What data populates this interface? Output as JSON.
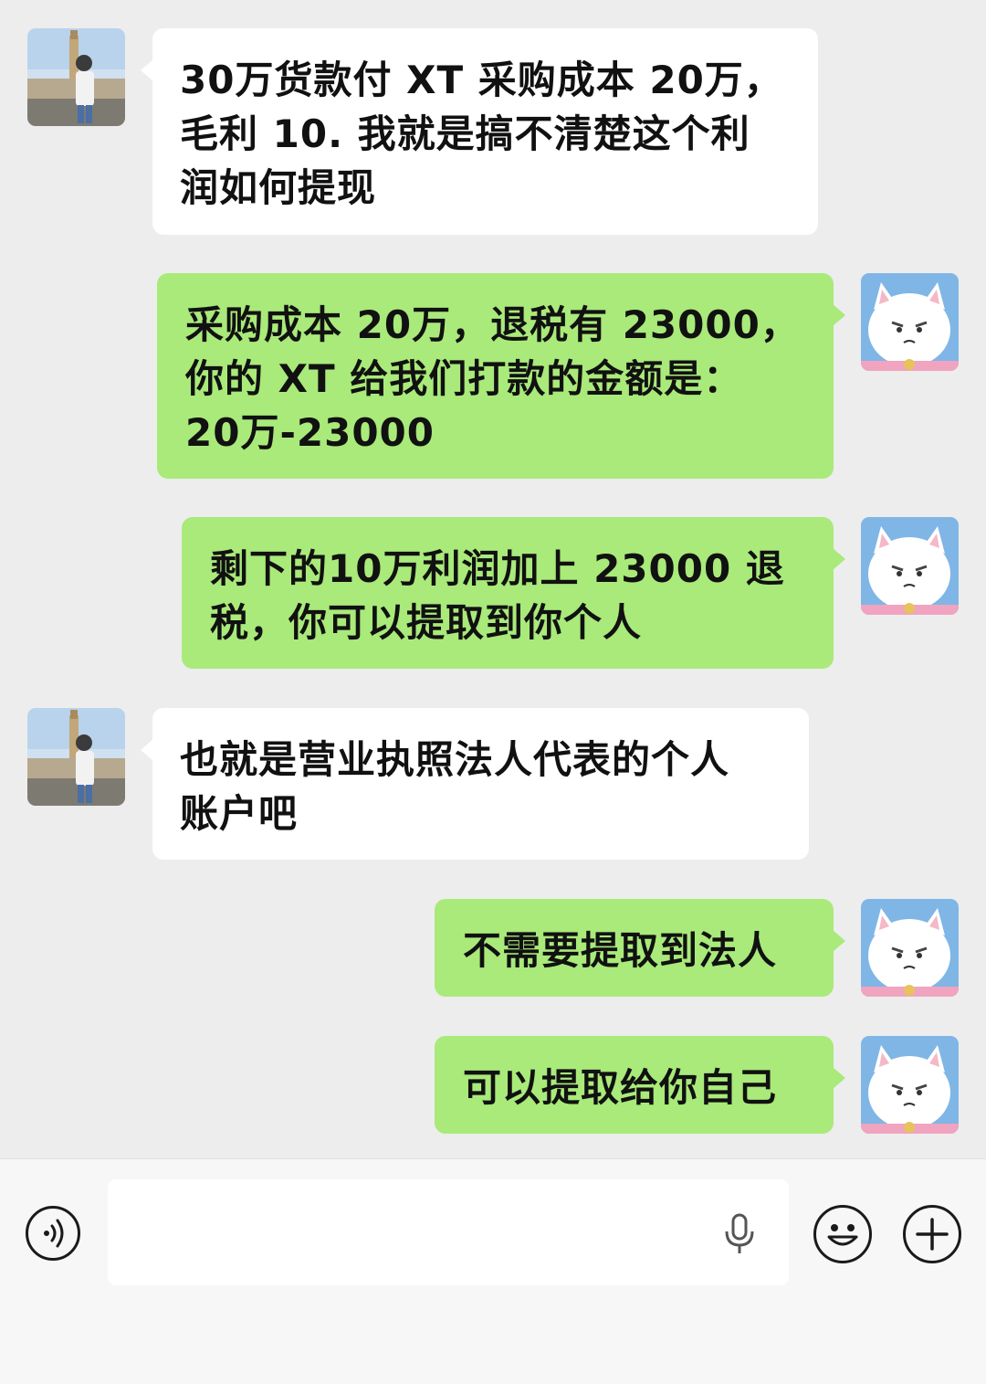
{
  "messages": [
    {
      "side": "in",
      "text": "30万货款付 XT 采购成本 20万，\n毛利 10. 我就是搞不清楚这个利\n润如何提现"
    },
    {
      "side": "out",
      "text": "采购成本 20万，退税有 23000，\n你的 XT 给我们打款的金额是：\n20万-23000"
    },
    {
      "side": "out",
      "text": "剩下的10万利润加上 23000 退\n税，你可以提取到你个人"
    },
    {
      "side": "in",
      "text": "也就是营业执照法人代表的个人\n账户吧"
    },
    {
      "side": "out",
      "text": "不需要提取到法人"
    },
    {
      "side": "out",
      "text": "可以提取给你自己"
    }
  ],
  "input_bar": {
    "voice_icon": "voice-wave-icon",
    "text_value": "",
    "mic_icon": "microphone-icon",
    "emoji_icon": "smiley-icon",
    "plus_icon": "plus-icon"
  },
  "colors": {
    "background": "#ededed",
    "bubble_in": "#ffffff",
    "bubble_out": "#a9ea7a"
  }
}
